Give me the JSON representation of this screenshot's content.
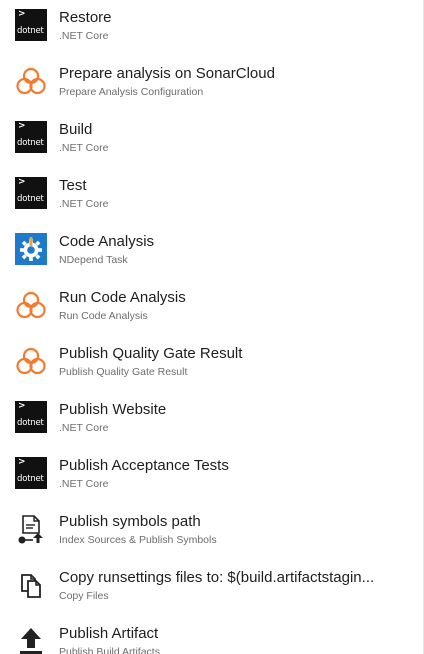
{
  "tasks": [
    {
      "title": "Restore",
      "subtitle": ".NET Core",
      "icon": "dotnet-icon"
    },
    {
      "title": "Prepare analysis on SonarCloud",
      "subtitle": "Prepare Analysis Configuration",
      "icon": "sonarcloud-icon"
    },
    {
      "title": "Build",
      "subtitle": ".NET Core",
      "icon": "dotnet-icon"
    },
    {
      "title": "Test",
      "subtitle": ".NET Core",
      "icon": "dotnet-icon"
    },
    {
      "title": "Code Analysis",
      "subtitle": "NDepend Task",
      "icon": "ndepend-icon"
    },
    {
      "title": "Run Code Analysis",
      "subtitle": "Run Code Analysis",
      "icon": "sonarcloud-icon"
    },
    {
      "title": "Publish Quality Gate Result",
      "subtitle": "Publish Quality Gate Result",
      "icon": "sonarcloud-icon"
    },
    {
      "title": "Publish Website",
      "subtitle": ".NET Core",
      "icon": "dotnet-icon"
    },
    {
      "title": "Publish Acceptance Tests",
      "subtitle": ".NET Core",
      "icon": "dotnet-icon"
    },
    {
      "title": "Publish symbols path",
      "subtitle": "Index Sources & Publish Symbols",
      "icon": "publish-symbols-icon"
    },
    {
      "title": "Copy runsettings files to: $(build.artifactstagin...",
      "subtitle": "Copy Files",
      "icon": "copy-files-icon"
    },
    {
      "title": "Publish Artifact",
      "subtitle": "Publish Build Artifacts",
      "icon": "upload-artifact-icon"
    }
  ],
  "dotnet_label": "dotnet",
  "dotnet_chevron": ">",
  "colors": {
    "sonar_orange": "#f37b2f",
    "ndepend_blue": "#1f7bc9",
    "dotnet_bg": "#111111",
    "title_text": "#1e1e1e",
    "subtitle_text": "#6d6d6d"
  }
}
